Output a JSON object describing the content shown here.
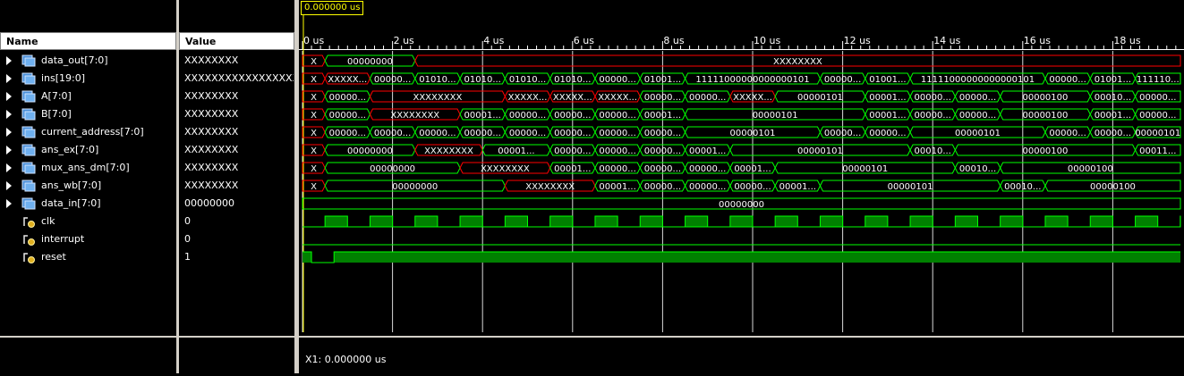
{
  "headers": {
    "name": "Name",
    "value": "Value"
  },
  "cursor_time": "0.000000 us",
  "cursor_status": "X1: 0.000000 us",
  "time_axis": {
    "ticks": [
      "0 us",
      "2 us",
      "4 us",
      "6 us",
      "8 us",
      "10 us",
      "12 us",
      "14 us",
      "16 us",
      "18 us"
    ],
    "end_us": 19.6
  },
  "colors": {
    "valid": "#00ff00",
    "unknown": "#ff0000",
    "fill": "#008000",
    "grid": "#ffffff",
    "text": "#ffffff"
  },
  "signals": [
    {
      "name": "data_out[7:0]",
      "value": "XXXXXXXX",
      "kind": "bus",
      "icon": "bus-icon",
      "segments": [
        {
          "s": 0,
          "e": 0.5,
          "t": "X",
          "u": true
        },
        {
          "s": 0.5,
          "e": 2.5,
          "t": "00000000"
        },
        {
          "s": 2.5,
          "e": 19.6,
          "t": "XXXXXXXX",
          "u": true
        }
      ]
    },
    {
      "name": "ins[19:0]",
      "value": "XXXXXXXXXXXXXXXXXXXX",
      "kind": "bus",
      "icon": "bus-icon",
      "segments": [
        {
          "s": 0,
          "e": 0.5,
          "t": "X",
          "u": true
        },
        {
          "s": 0.5,
          "e": 1.5,
          "t": "XXXXX...",
          "u": true
        },
        {
          "s": 1.5,
          "e": 2.5,
          "t": "00000..."
        },
        {
          "s": 2.5,
          "e": 3.5,
          "t": "01010..."
        },
        {
          "s": 3.5,
          "e": 4.5,
          "t": "01010..."
        },
        {
          "s": 4.5,
          "e": 5.5,
          "t": "01010..."
        },
        {
          "s": 5.5,
          "e": 6.5,
          "t": "01010..."
        },
        {
          "s": 6.5,
          "e": 7.5,
          "t": "00000..."
        },
        {
          "s": 7.5,
          "e": 8.5,
          "t": "01001..."
        },
        {
          "s": 8.5,
          "e": 11.5,
          "t": "11111000000000000101"
        },
        {
          "s": 11.5,
          "e": 12.5,
          "t": "00000..."
        },
        {
          "s": 12.5,
          "e": 13.5,
          "t": "01001..."
        },
        {
          "s": 13.5,
          "e": 16.5,
          "t": "11111000000000000101"
        },
        {
          "s": 16.5,
          "e": 17.5,
          "t": "00000..."
        },
        {
          "s": 17.5,
          "e": 18.5,
          "t": "01001..."
        },
        {
          "s": 18.5,
          "e": 19.6,
          "t": "111110..."
        }
      ]
    },
    {
      "name": "A[7:0]",
      "value": "XXXXXXXX",
      "kind": "bus",
      "icon": "bus-icon",
      "segments": [
        {
          "s": 0,
          "e": 0.5,
          "t": "X",
          "u": true
        },
        {
          "s": 0.5,
          "e": 1.5,
          "t": "00000..."
        },
        {
          "s": 1.5,
          "e": 4.5,
          "t": "XXXXXXXX",
          "u": true
        },
        {
          "s": 4.5,
          "e": 5.5,
          "t": "XXXXX...",
          "u": true
        },
        {
          "s": 5.5,
          "e": 6.5,
          "t": "XXXXX...",
          "u": true
        },
        {
          "s": 6.5,
          "e": 7.5,
          "t": "XXXXX...",
          "u": true
        },
        {
          "s": 7.5,
          "e": 8.5,
          "t": "00000..."
        },
        {
          "s": 8.5,
          "e": 9.5,
          "t": "00000..."
        },
        {
          "s": 9.5,
          "e": 10.5,
          "t": "XXXXX...",
          "u": true
        },
        {
          "s": 10.5,
          "e": 12.5,
          "t": "00000101"
        },
        {
          "s": 12.5,
          "e": 13.5,
          "t": "00001..."
        },
        {
          "s": 13.5,
          "e": 14.5,
          "t": "00000..."
        },
        {
          "s": 14.5,
          "e": 15.5,
          "t": "00000..."
        },
        {
          "s": 15.5,
          "e": 17.5,
          "t": "00000100"
        },
        {
          "s": 17.5,
          "e": 18.5,
          "t": "00010..."
        },
        {
          "s": 18.5,
          "e": 19.6,
          "t": "00000..."
        }
      ]
    },
    {
      "name": "B[7:0]",
      "value": "XXXXXXXX",
      "kind": "bus",
      "icon": "bus-icon",
      "segments": [
        {
          "s": 0,
          "e": 0.5,
          "t": "X",
          "u": true
        },
        {
          "s": 0.5,
          "e": 1.5,
          "t": "00000..."
        },
        {
          "s": 1.5,
          "e": 3.5,
          "t": "XXXXXXXX",
          "u": true
        },
        {
          "s": 3.5,
          "e": 4.5,
          "t": "00001..."
        },
        {
          "s": 4.5,
          "e": 5.5,
          "t": "00000..."
        },
        {
          "s": 5.5,
          "e": 6.5,
          "t": "00000..."
        },
        {
          "s": 6.5,
          "e": 7.5,
          "t": "00000..."
        },
        {
          "s": 7.5,
          "e": 8.5,
          "t": "00001..."
        },
        {
          "s": 8.5,
          "e": 12.5,
          "t": "00000101"
        },
        {
          "s": 12.5,
          "e": 13.5,
          "t": "00001..."
        },
        {
          "s": 13.5,
          "e": 14.5,
          "t": "00000..."
        },
        {
          "s": 14.5,
          "e": 15.5,
          "t": "00000..."
        },
        {
          "s": 15.5,
          "e": 17.5,
          "t": "00000100"
        },
        {
          "s": 17.5,
          "e": 18.5,
          "t": "00001..."
        },
        {
          "s": 18.5,
          "e": 19.6,
          "t": "00000..."
        }
      ]
    },
    {
      "name": "current_address[7:0]",
      "value": "XXXXXXXX",
      "kind": "bus",
      "icon": "bus-icon",
      "segments": [
        {
          "s": 0,
          "e": 0.5,
          "t": "X",
          "u": true
        },
        {
          "s": 0.5,
          "e": 1.5,
          "t": "00000..."
        },
        {
          "s": 1.5,
          "e": 2.5,
          "t": "00000..."
        },
        {
          "s": 2.5,
          "e": 3.5,
          "t": "00000..."
        },
        {
          "s": 3.5,
          "e": 4.5,
          "t": "00000..."
        },
        {
          "s": 4.5,
          "e": 5.5,
          "t": "00000..."
        },
        {
          "s": 5.5,
          "e": 6.5,
          "t": "00000..."
        },
        {
          "s": 6.5,
          "e": 7.5,
          "t": "00000..."
        },
        {
          "s": 7.5,
          "e": 8.5,
          "t": "00000..."
        },
        {
          "s": 8.5,
          "e": 11.5,
          "t": "00000101"
        },
        {
          "s": 11.5,
          "e": 12.5,
          "t": "00000..."
        },
        {
          "s": 12.5,
          "e": 13.5,
          "t": "00000..."
        },
        {
          "s": 13.5,
          "e": 16.5,
          "t": "00000101"
        },
        {
          "s": 16.5,
          "e": 17.5,
          "t": "00000..."
        },
        {
          "s": 17.5,
          "e": 18.5,
          "t": "00000..."
        },
        {
          "s": 18.5,
          "e": 19.6,
          "t": "00000101"
        }
      ]
    },
    {
      "name": "ans_ex[7:0]",
      "value": "XXXXXXXX",
      "kind": "bus",
      "icon": "bus-icon",
      "segments": [
        {
          "s": 0,
          "e": 0.5,
          "t": "X",
          "u": true
        },
        {
          "s": 0.5,
          "e": 2.5,
          "t": "00000000"
        },
        {
          "s": 2.5,
          "e": 4.0,
          "t": "XXXXXXXX",
          "u": true
        },
        {
          "s": 4.0,
          "e": 5.5,
          "t": "00001..."
        },
        {
          "s": 5.5,
          "e": 6.5,
          "t": "00000..."
        },
        {
          "s": 6.5,
          "e": 7.5,
          "t": "00000..."
        },
        {
          "s": 7.5,
          "e": 8.5,
          "t": "00000..."
        },
        {
          "s": 8.5,
          "e": 9.5,
          "t": "00001..."
        },
        {
          "s": 9.5,
          "e": 13.5,
          "t": "00000101"
        },
        {
          "s": 13.5,
          "e": 14.5,
          "t": "00010..."
        },
        {
          "s": 14.5,
          "e": 18.5,
          "t": "00000100"
        },
        {
          "s": 18.5,
          "e": 19.6,
          "t": "00011..."
        }
      ]
    },
    {
      "name": "mux_ans_dm[7:0]",
      "value": "XXXXXXXX",
      "kind": "bus",
      "icon": "bus-icon",
      "segments": [
        {
          "s": 0,
          "e": 0.5,
          "t": "X",
          "u": true
        },
        {
          "s": 0.5,
          "e": 3.5,
          "t": "00000000"
        },
        {
          "s": 3.5,
          "e": 5.5,
          "t": "XXXXXXXX",
          "u": true
        },
        {
          "s": 5.5,
          "e": 6.5,
          "t": "00001..."
        },
        {
          "s": 6.5,
          "e": 7.5,
          "t": "00000..."
        },
        {
          "s": 7.5,
          "e": 8.5,
          "t": "00000..."
        },
        {
          "s": 8.5,
          "e": 9.5,
          "t": "00000..."
        },
        {
          "s": 9.5,
          "e": 10.5,
          "t": "00001..."
        },
        {
          "s": 10.5,
          "e": 14.5,
          "t": "00000101"
        },
        {
          "s": 14.5,
          "e": 15.5,
          "t": "00010..."
        },
        {
          "s": 15.5,
          "e": 19.6,
          "t": "00000100"
        }
      ]
    },
    {
      "name": "ans_wb[7:0]",
      "value": "XXXXXXXX",
      "kind": "bus",
      "icon": "bus-icon",
      "segments": [
        {
          "s": 0,
          "e": 0.5,
          "t": "X",
          "u": true
        },
        {
          "s": 0.5,
          "e": 4.5,
          "t": "00000000"
        },
        {
          "s": 4.5,
          "e": 6.5,
          "t": "XXXXXXXX",
          "u": true
        },
        {
          "s": 6.5,
          "e": 7.5,
          "t": "00001..."
        },
        {
          "s": 7.5,
          "e": 8.5,
          "t": "00000..."
        },
        {
          "s": 8.5,
          "e": 9.5,
          "t": "00000..."
        },
        {
          "s": 9.5,
          "e": 10.5,
          "t": "00000..."
        },
        {
          "s": 10.5,
          "e": 11.5,
          "t": "00001..."
        },
        {
          "s": 11.5,
          "e": 15.5,
          "t": "00000101"
        },
        {
          "s": 15.5,
          "e": 16.5,
          "t": "00010..."
        },
        {
          "s": 16.5,
          "e": 19.6,
          "t": "00000100"
        }
      ]
    },
    {
      "name": "data_in[7:0]",
      "value": "00000000",
      "kind": "bus",
      "icon": "bus-icon",
      "segments": [
        {
          "s": 0,
          "e": 19.6,
          "t": "00000000"
        }
      ]
    },
    {
      "name": "clk",
      "value": "0",
      "kind": "bit",
      "icon": "bit-icon",
      "wave": "clock",
      "period": 1.0,
      "high_offset": 0.5
    },
    {
      "name": "interrupt",
      "value": "0",
      "kind": "bit",
      "icon": "bit-icon",
      "wave": "low"
    },
    {
      "name": "reset",
      "value": "1",
      "kind": "bit",
      "icon": "bit-icon",
      "wave": "reset",
      "low_from": 0.2,
      "low_to": 0.7
    }
  ]
}
